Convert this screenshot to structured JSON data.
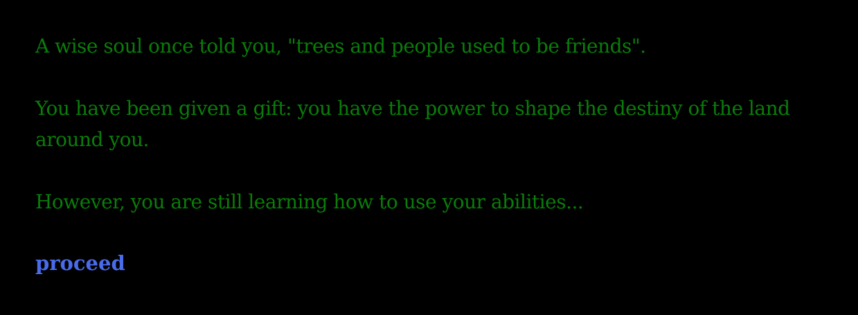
{
  "story": {
    "paragraphs": [
      "A wise soul once told you, \"trees and people used to be friends\".",
      "You have been given a gift: you have the power to shape the destiny of the land around you.",
      "However, you are still learning how to use your abilities..."
    ],
    "proceed_label": "proceed"
  },
  "colors": {
    "background": "#000000",
    "text": "#0a7d0a",
    "link": "#4a6bea"
  }
}
